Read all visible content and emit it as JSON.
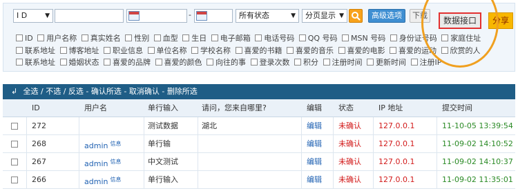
{
  "toolbar": {
    "id_select": "I D",
    "keyword_value": "",
    "date_separator": "-",
    "status_select": "所有状态",
    "paging_select": "分页显示",
    "advanced_button": "高级选项",
    "download_button": "下载",
    "api_button": "数据接口",
    "share_button": "分享"
  },
  "fields": [
    "ID",
    "用户名称",
    "真实姓名",
    "性别",
    "血型",
    "生日",
    "电子邮箱",
    "电话号码",
    "QQ 号码",
    "MSN 号码",
    "身份证号码",
    "家庭住址",
    "联系地址",
    "博客地址",
    "职业信息",
    "单位名称",
    "学校名称",
    "喜爱的书籍",
    "喜爱的音乐",
    "喜爱的电影",
    "喜爱的运动",
    "欣赏的人",
    "联系地址",
    "婚姻状态",
    "喜爱的品牌",
    "喜爱的颜色",
    "向往的事",
    "登录次数",
    "积分",
    "注册时间",
    "更新时间",
    "注册IP"
  ],
  "table": {
    "actions": {
      "select_all": "全选",
      "select_none": "不选",
      "invert": "反选",
      "confirm": "确认所选",
      "cancel": "取消确认",
      "delete": "删除所选"
    },
    "headers": [
      "ID",
      "用户名",
      "单行输入",
      "请问，您来自哪里?",
      "编辑",
      "状态",
      "IP 地址",
      "提交时间"
    ],
    "rows": [
      {
        "id": "272",
        "user": "",
        "user_tag": "",
        "single": "测试数据",
        "from": "湖北",
        "edit": "编辑",
        "status": "未确认",
        "ip": "127.0.0.1",
        "time": "11-10-05 13:39:54"
      },
      {
        "id": "268",
        "user": "admin",
        "user_tag": "信息",
        "single": "单行输",
        "from": "",
        "edit": "编辑",
        "status": "未确认",
        "ip": "127.0.0.1",
        "time": "11-09-02 14:10:52"
      },
      {
        "id": "267",
        "user": "admin",
        "user_tag": "信息",
        "single": "中文测试",
        "from": "",
        "edit": "编辑",
        "status": "未确认",
        "ip": "127.0.0.1",
        "time": "11-09-02 14:10:37"
      },
      {
        "id": "266",
        "user": "admin",
        "user_tag": "信息",
        "single": "单行输入",
        "from": "",
        "edit": "编辑",
        "status": "未确认",
        "ip": "127.0.0.1",
        "time": "11-09-02 11:35:01"
      }
    ]
  },
  "colors": {
    "header_bar": "#1f5d86",
    "highlight_circle": "#f0a020",
    "highlight_border": "#e23030",
    "status_red": "#d21a1a",
    "time_green": "#2a8a25",
    "link_blue": "#2263b3"
  },
  "icons": [
    "calendar-icon",
    "search-icon",
    "select-arrow-icon",
    "return-arrow-icon"
  ]
}
